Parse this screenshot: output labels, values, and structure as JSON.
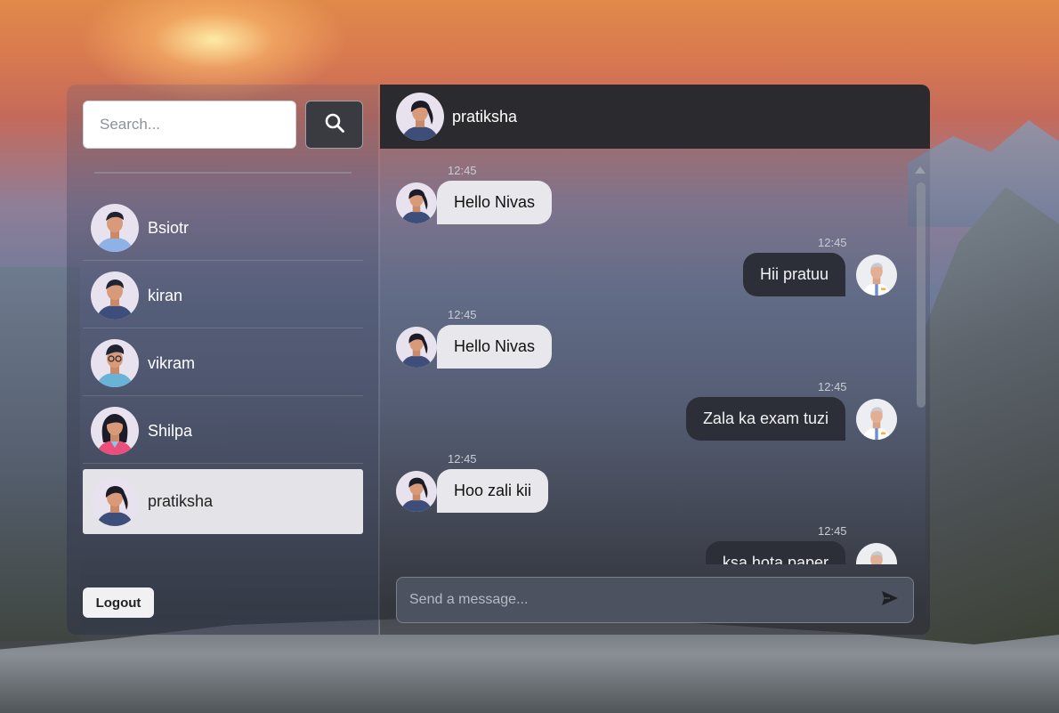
{
  "search": {
    "placeholder": "Search..."
  },
  "contacts": [
    {
      "name": "Bsiotr",
      "avatar": "man-icon"
    },
    {
      "name": "kiran",
      "avatar": "man-icon"
    },
    {
      "name": "vikram",
      "avatar": "man-glasses-icon"
    },
    {
      "name": "Shilpa",
      "avatar": "woman-icon"
    },
    {
      "name": "pratiksha",
      "avatar": "woman-icon",
      "active": true
    }
  ],
  "logout_label": "Logout",
  "chat": {
    "title": "pratiksha",
    "messages": [
      {
        "direction": "in",
        "time": "12:45",
        "text": "Hello Nivas"
      },
      {
        "direction": "out",
        "time": "12:45",
        "text": "Hii pratuu"
      },
      {
        "direction": "in",
        "time": "12:45",
        "text": "Hello Nivas"
      },
      {
        "direction": "out",
        "time": "12:45",
        "text": "Zala ka exam tuzi"
      },
      {
        "direction": "in",
        "time": "12:45",
        "text": "Hoo zali kii"
      },
      {
        "direction": "out",
        "time": "12:45",
        "text": "ksa hota paper"
      }
    ],
    "composer_placeholder": "Send a message..."
  },
  "colors": {
    "header_bg": "#2b2b2f",
    "incoming_bubble": "#e8e8ec",
    "outgoing_bubble": "#2c2f38",
    "active_contact": "#e4e4e8"
  }
}
